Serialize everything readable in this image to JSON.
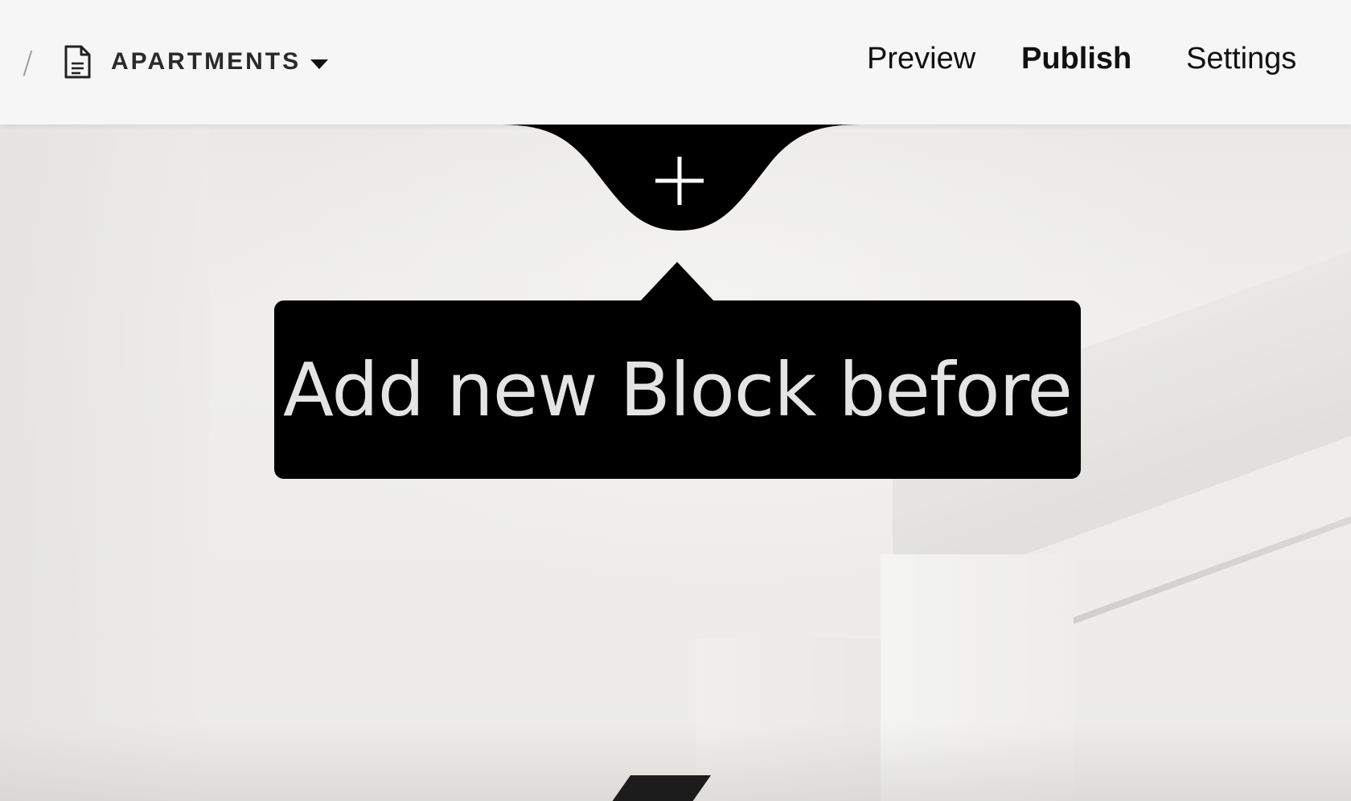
{
  "header": {
    "breadcrumb_separator": "/",
    "page_name": "APARTMENTS",
    "nav": {
      "preview": "Preview",
      "publish": "Publish",
      "settings": "Settings"
    }
  },
  "add_block": {
    "icon": "plus-icon",
    "tooltip": "Add new Block before"
  },
  "icons": {
    "document": "document-icon",
    "dropdown": "caret-down-icon"
  },
  "colors": {
    "topbar_bg": "#f6f6f6",
    "tooltip_bg": "#000000",
    "tooltip_text": "#e4e4e4"
  }
}
